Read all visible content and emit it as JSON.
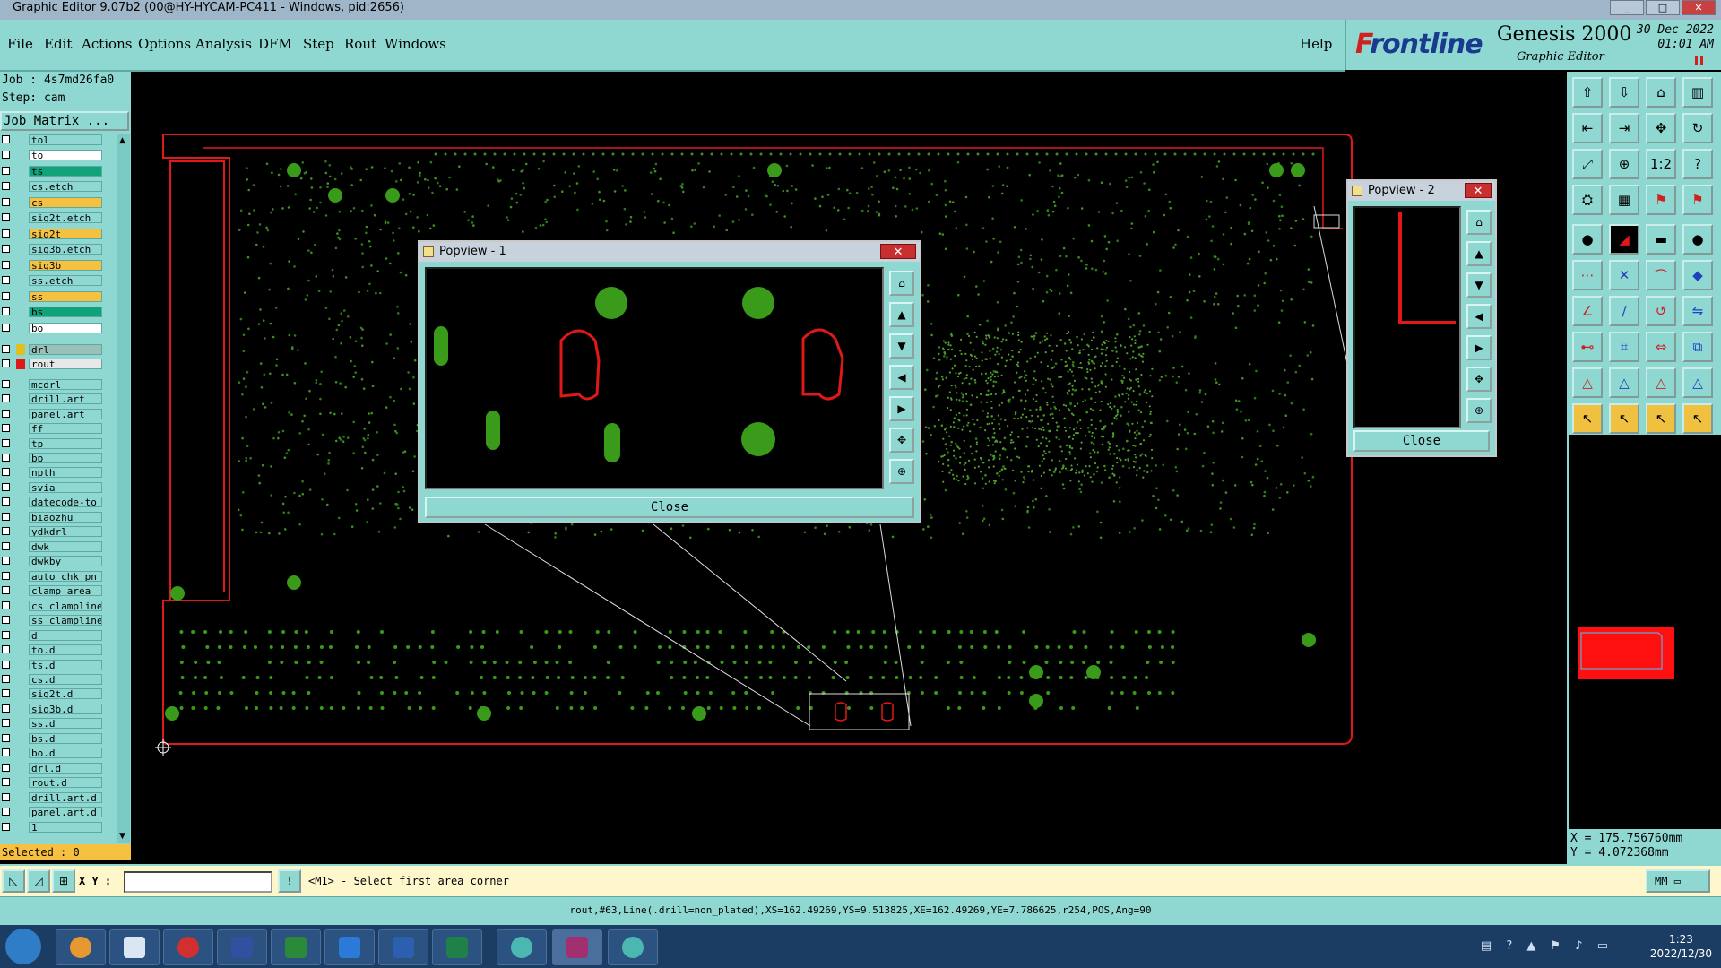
{
  "window": {
    "title": "Graphic Editor 9.07b2 (00@HY-HYCAM-PC411 - Windows, pid:2656)",
    "controls": [
      "_",
      "□",
      "✕"
    ]
  },
  "menu": [
    "File",
    "Edit",
    "Actions",
    "Options",
    "Analysis",
    "DFM",
    "Step",
    "Rout",
    "Windows"
  ],
  "help_label": "Help",
  "brand": {
    "logo_f": "F",
    "logo_rest": "rontline",
    "product": "Genesis 2000",
    "sub": "Graphic Editor",
    "date_line1": "30 Dec 2022",
    "date_line2": "01:01 AM"
  },
  "job": {
    "job_line": "Job : 4s7md26fa0",
    "step_line": "Step: cam",
    "matrix_label": "Job Matrix ..."
  },
  "layers": [
    {
      "name": "tol",
      "color": "#8fd8d2"
    },
    {
      "name": "to",
      "color": "#ffffff"
    },
    {
      "name": "ts",
      "color": "#12a27a"
    },
    {
      "name": "cs.etch",
      "color": "#8fd8d2"
    },
    {
      "name": "cs",
      "color": "#f6c040"
    },
    {
      "name": "sig2t.etch",
      "color": "#8fd8d2"
    },
    {
      "name": "sig2t",
      "color": "#f6c040"
    },
    {
      "name": "sig3b.etch",
      "color": "#8fd8d2"
    },
    {
      "name": "sig3b",
      "color": "#f6c040"
    },
    {
      "name": "ss.etch",
      "color": "#8fd8d2"
    },
    {
      "name": "ss",
      "color": "#f6c040"
    },
    {
      "name": "bs",
      "color": "#12a27a"
    },
    {
      "name": "bo",
      "color": "#ffffff"
    },
    {
      "name": "drl",
      "color": "#9ac0b8"
    },
    {
      "name": "rout",
      "color": "#e8e8e8"
    },
    {
      "name": "mcdrl",
      "color": "#8fd8d2"
    },
    {
      "name": "drill.art",
      "color": "#8fd8d2"
    },
    {
      "name": "panel.art",
      "color": "#8fd8d2"
    },
    {
      "name": "ff",
      "color": "#8fd8d2"
    },
    {
      "name": "tp",
      "color": "#8fd8d2"
    },
    {
      "name": "bp",
      "color": "#8fd8d2"
    },
    {
      "name": "npth",
      "color": "#8fd8d2"
    },
    {
      "name": "svia",
      "color": "#8fd8d2"
    },
    {
      "name": "datecode-to",
      "color": "#8fd8d2"
    },
    {
      "name": "biaozhu",
      "color": "#8fd8d2"
    },
    {
      "name": "ydkdrl",
      "color": "#8fd8d2"
    },
    {
      "name": "dwk",
      "color": "#8fd8d2"
    },
    {
      "name": "dwkby",
      "color": "#8fd8d2"
    },
    {
      "name": "auto_chk_pn",
      "color": "#8fd8d2"
    },
    {
      "name": "clamp_area",
      "color": "#8fd8d2"
    },
    {
      "name": "cs_clampline",
      "color": "#8fd8d2"
    },
    {
      "name": "ss_clampline",
      "color": "#8fd8d2"
    },
    {
      "name": "d",
      "color": "#8fd8d2"
    },
    {
      "name": "to.d",
      "color": "#8fd8d2"
    },
    {
      "name": "ts.d",
      "color": "#8fd8d2"
    },
    {
      "name": "cs.d",
      "color": "#8fd8d2"
    },
    {
      "name": "sig2t.d",
      "color": "#8fd8d2"
    },
    {
      "name": "sig3b.d",
      "color": "#8fd8d2"
    },
    {
      "name": "ss.d",
      "color": "#8fd8d2"
    },
    {
      "name": "bs.d",
      "color": "#8fd8d2"
    },
    {
      "name": "bo.d",
      "color": "#8fd8d2"
    },
    {
      "name": "drl.d",
      "color": "#8fd8d2"
    },
    {
      "name": "rout.d",
      "color": "#8fd8d2"
    },
    {
      "name": "drill.art.d",
      "color": "#8fd8d2"
    },
    {
      "name": "panel.art.d",
      "color": "#8fd8d2"
    },
    {
      "name": "1",
      "color": "#8fd8d2"
    }
  ],
  "selected_label": "Selected : 0",
  "popview1": {
    "title": "Popview - 1",
    "close_label": "Close"
  },
  "popview2": {
    "title": "Popview - 2",
    "close_label": "Close"
  },
  "coords": {
    "x_line": "X = 175.756760mm",
    "y_line": "Y = 4.072368mm"
  },
  "command": {
    "xy_label": "X Y :",
    "xy_value": "",
    "prompt": "<M1> - Select first area corner",
    "units": "MM"
  },
  "status_line": "rout,#63,Line(.drill=non_plated),XS=162.49269,YS=9.513825,XE=162.49269,YE=7.786625,r254,POS,Ang=90",
  "taskbar": {
    "clock_time": "1:23",
    "clock_date": "2022/12/30"
  },
  "toolbar_buttons": [
    "step-in-icon",
    "step-out-icon",
    "home-icon",
    "split-icon",
    "left-icon",
    "right-icon",
    "pan-icon",
    "redraw-icon",
    "fit-icon",
    "zoom-icon",
    "one-to-one-icon",
    "help-icon",
    "grid-icon",
    "snap-icon",
    "layer-red-icon",
    "layer-blue-icon",
    "pad-icon",
    "line-icon",
    "surface-icon",
    "circle-icon",
    "connect-icon",
    "cross-icon",
    "arc-icon",
    "node-icon",
    "add-line-icon",
    "add-slash-icon",
    "rotate-icon",
    "mirror-icon",
    "move-icon",
    "stretch-icon",
    "measure-icon",
    "copy-icon",
    "triangle-icon",
    "a-shape-icon",
    "a-fill-icon",
    "a-dark-icon",
    "select-icon",
    "select-touch-icon",
    "select-inside-icon",
    "select-net-icon"
  ]
}
